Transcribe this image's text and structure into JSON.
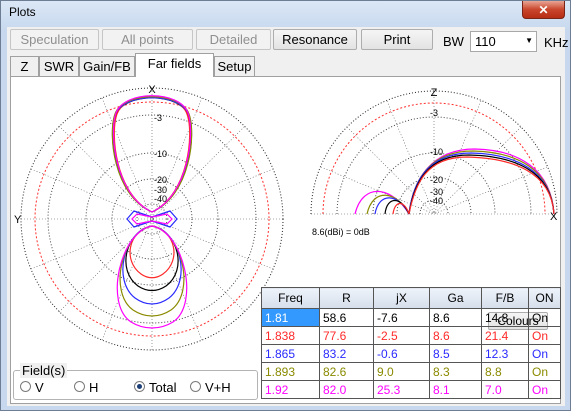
{
  "window": {
    "title": "Plots",
    "close_glyph": "✕"
  },
  "toolbar": {
    "speculation": "Speculation",
    "all_points": "All points",
    "detailed": "Detailed",
    "resonance": "Resonance",
    "print": "Print",
    "bw_label": "BW",
    "bw_value": "110",
    "bw_unit": "KHz"
  },
  "tabs": [
    {
      "label": "Z",
      "active": false
    },
    {
      "label": "SWR",
      "active": false
    },
    {
      "label": "Gain/FB",
      "active": false
    },
    {
      "label": "Far fields",
      "active": true
    },
    {
      "label": "Setup",
      "active": false
    }
  ],
  "azimuth_plot": {
    "axis_labels": {
      "top": "X",
      "left": "Y"
    },
    "ring_labels": [
      "-3",
      "-10",
      "-20",
      "-30",
      "-40"
    ]
  },
  "elevation_plot": {
    "axis_labels": {
      "top": "Z",
      "right": "X"
    },
    "ring_labels": [
      "-3",
      "-10",
      "-20",
      "-30",
      "-40"
    ],
    "reference": "8.6(dBi) = 0dB"
  },
  "colours_button": "Colours",
  "table": {
    "columns": [
      "Freq",
      "R",
      "jX",
      "Ga",
      "F/B",
      "ON"
    ],
    "rows": [
      {
        "freq": "1.81",
        "r": "58.6",
        "jx": "-7.6",
        "ga": "8.6",
        "fb": "14.8",
        "on": "On",
        "color": "#000000",
        "selected": true
      },
      {
        "freq": "1.838",
        "r": "77.6",
        "jx": "-2.5",
        "ga": "8.6",
        "fb": "21.4",
        "on": "On",
        "color": "#ff2a2a",
        "selected": false
      },
      {
        "freq": "1.865",
        "r": "83.2",
        "jx": "-0.6",
        "ga": "8.5",
        "fb": "12.3",
        "on": "On",
        "color": "#2a2aff",
        "selected": false
      },
      {
        "freq": "1.893",
        "r": "82.6",
        "jx": "9.0",
        "ga": "8.3",
        "fb": "8.8",
        "on": "On",
        "color": "#8a8a00",
        "selected": false
      },
      {
        "freq": "1.92",
        "r": "82.0",
        "jx": "25.3",
        "ga": "8.1",
        "fb": "7.0",
        "on": "On",
        "color": "#ff00ff",
        "selected": false
      }
    ]
  },
  "fields": {
    "legend": "Field(s)",
    "options": [
      {
        "label": "V",
        "selected": false
      },
      {
        "label": "H",
        "selected": false
      },
      {
        "label": "Total",
        "selected": true
      },
      {
        "label": "V+H",
        "selected": false
      }
    ]
  }
}
